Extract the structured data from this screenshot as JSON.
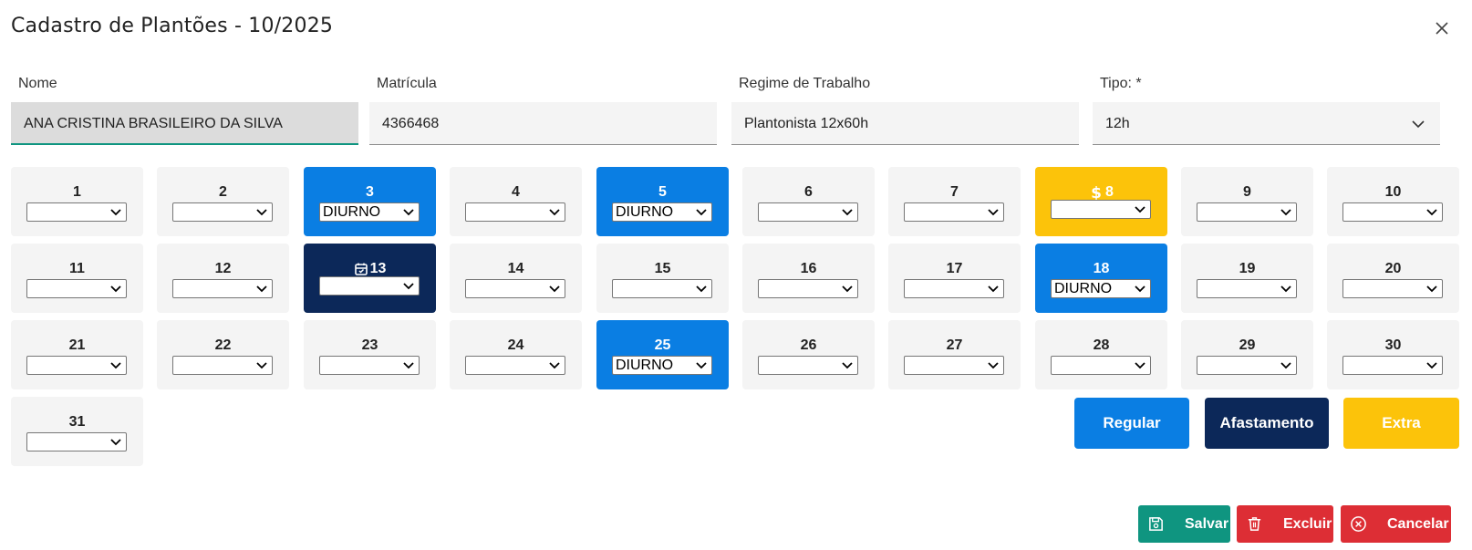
{
  "dialog": {
    "title": "Cadastro de Plantões - 10/2025"
  },
  "form": {
    "nome": {
      "label": "Nome",
      "value": "ANA CRISTINA BRASILEIRO DA SILVA"
    },
    "matricula": {
      "label": "Matrícula",
      "value": "4366468"
    },
    "regime": {
      "label": "Regime de Trabalho",
      "value": "Plantonista 12x60h"
    },
    "tipo": {
      "label": "Tipo: *",
      "value": "12h"
    }
  },
  "days": [
    {
      "num": "1",
      "value": "",
      "type": "none"
    },
    {
      "num": "2",
      "value": "",
      "type": "none"
    },
    {
      "num": "3",
      "value": "DIURNO",
      "type": "regular"
    },
    {
      "num": "4",
      "value": "",
      "type": "none"
    },
    {
      "num": "5",
      "value": "DIURNO",
      "type": "regular"
    },
    {
      "num": "6",
      "value": "",
      "type": "none"
    },
    {
      "num": "7",
      "value": "",
      "type": "none"
    },
    {
      "num": "8",
      "value": "",
      "type": "extra"
    },
    {
      "num": "9",
      "value": "",
      "type": "none"
    },
    {
      "num": "10",
      "value": "",
      "type": "none"
    },
    {
      "num": "11",
      "value": "",
      "type": "none"
    },
    {
      "num": "12",
      "value": "",
      "type": "none"
    },
    {
      "num": "13",
      "value": "",
      "type": "afastamento"
    },
    {
      "num": "14",
      "value": "",
      "type": "none"
    },
    {
      "num": "15",
      "value": "",
      "type": "none"
    },
    {
      "num": "16",
      "value": "",
      "type": "none"
    },
    {
      "num": "17",
      "value": "",
      "type": "none"
    },
    {
      "num": "18",
      "value": "DIURNO",
      "type": "regular"
    },
    {
      "num": "19",
      "value": "",
      "type": "none"
    },
    {
      "num": "20",
      "value": "",
      "type": "none"
    },
    {
      "num": "21",
      "value": "",
      "type": "none"
    },
    {
      "num": "22",
      "value": "",
      "type": "none"
    },
    {
      "num": "23",
      "value": "",
      "type": "none"
    },
    {
      "num": "24",
      "value": "",
      "type": "none"
    },
    {
      "num": "25",
      "value": "DIURNO",
      "type": "regular"
    },
    {
      "num": "26",
      "value": "",
      "type": "none"
    },
    {
      "num": "27",
      "value": "",
      "type": "none"
    },
    {
      "num": "28",
      "value": "",
      "type": "none"
    },
    {
      "num": "29",
      "value": "",
      "type": "none"
    },
    {
      "num": "30",
      "value": "",
      "type": "none"
    },
    {
      "num": "31",
      "value": "",
      "type": "none"
    }
  ],
  "legend": {
    "regular": "Regular",
    "afastamento": "Afastamento",
    "extra": "Extra"
  },
  "actions": {
    "save": "Salvar",
    "delete": "Excluir",
    "cancel": "Cancelar"
  },
  "icons": {
    "close": "close-icon",
    "dropdown": "chevron-down-icon",
    "extra_marker": "dollar-icon",
    "afastamento_marker": "calendar-icon",
    "save": "floppy-disk-icon",
    "delete": "trash-icon",
    "cancel": "x-circle-icon"
  },
  "colors": {
    "regular": "#0a7ee3",
    "afastamento": "#0c2859",
    "extra": "#fcc30a",
    "save": "#0f9580",
    "danger": "#dd2e35",
    "empty_day": "#f4f4f4"
  }
}
